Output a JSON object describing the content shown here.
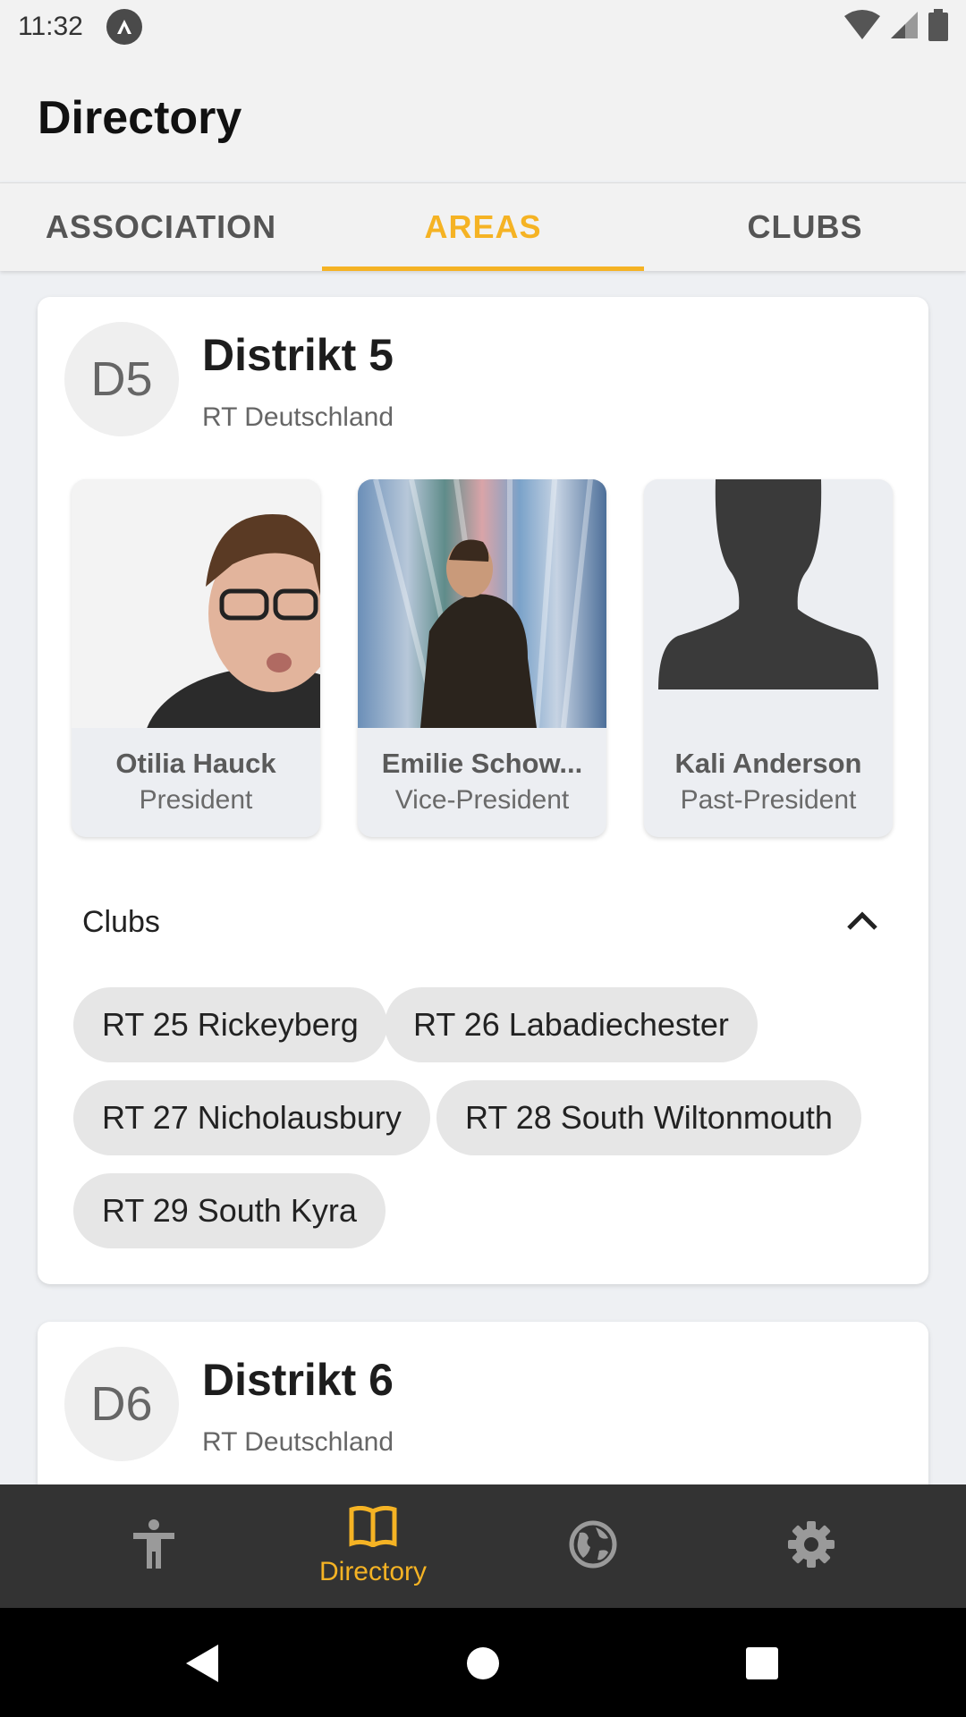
{
  "status_bar": {
    "time": "11:32"
  },
  "header": {
    "title": "Directory"
  },
  "tabs": [
    {
      "label": "ASSOCIATION"
    },
    {
      "label": "AREAS"
    },
    {
      "label": "CLUBS"
    }
  ],
  "districts": [
    {
      "badge": "D5",
      "title": "Distrikt 5",
      "subtitle": "RT Deutschland",
      "people": [
        {
          "name": "Otilia Hauck",
          "role": "President"
        },
        {
          "name": "Emilie Schow...",
          "role": "Vice-President"
        },
        {
          "name": "Kali Anderson",
          "role": "Past-President"
        }
      ],
      "clubs_label": "Clubs",
      "clubs": [
        "RT 25 Rickeyberg",
        "RT 26 Labadiechester",
        "RT 27 Nicholausbury",
        "RT 28 South Wiltonmouth",
        "RT 29 South Kyra"
      ]
    },
    {
      "badge": "D6",
      "title": "Distrikt 6",
      "subtitle": "RT Deutschland"
    }
  ],
  "bottom_nav": {
    "items": [
      {
        "icon": "accessibility-icon"
      },
      {
        "icon": "book-icon",
        "label": "Directory"
      },
      {
        "icon": "globe-icon"
      },
      {
        "icon": "gear-icon"
      }
    ]
  },
  "colors": {
    "accent": "#f5b324",
    "nav_background": "#333333",
    "icon_inactive": "#9a9a9a"
  }
}
